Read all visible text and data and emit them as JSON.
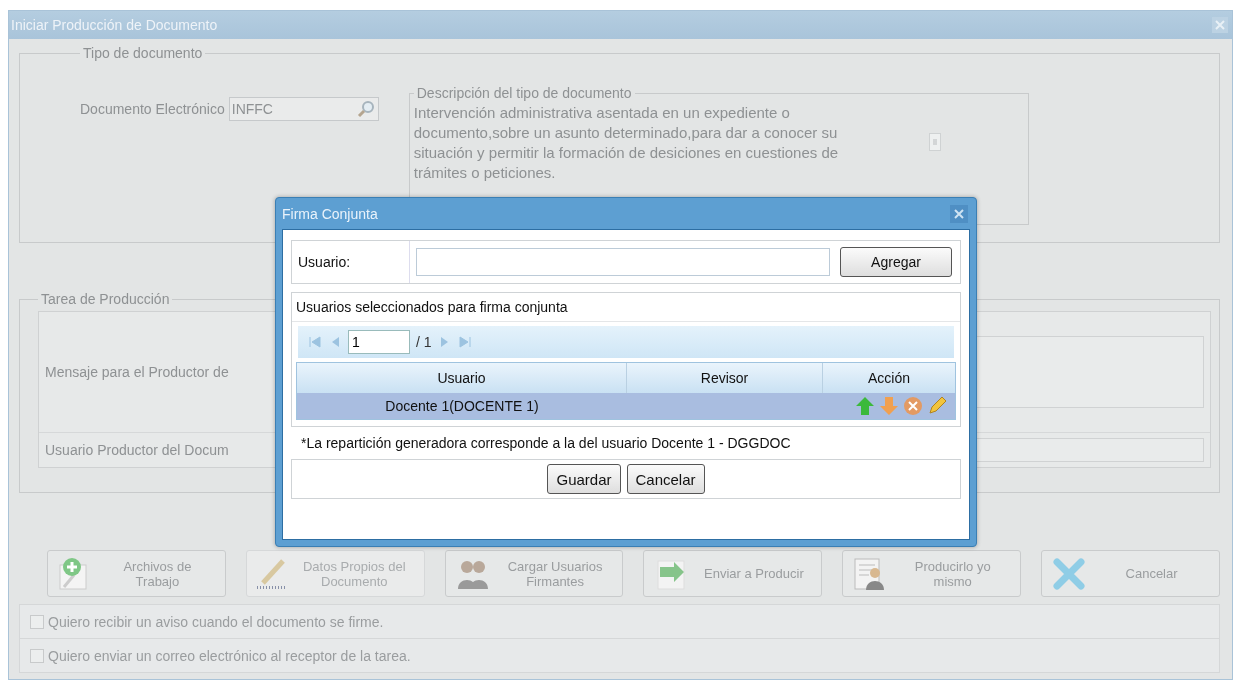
{
  "window": {
    "title": "Iniciar Producción de Documento"
  },
  "tipo_documento": {
    "legend": "Tipo de documento",
    "field_label": "Documento Electrónico",
    "field_value": "INFFC",
    "description": {
      "legend": "Descripción del tipo de documento",
      "text": "Intervención administrativa asentada en un expediente o documento,sobre un asunto determinado,para dar a conocer su situación y permitir la formación de desiciones en cuestiones de trámites o peticiones."
    }
  },
  "tarea": {
    "legend": "Tarea de Producción",
    "message_label": "Mensaje para el Productor de",
    "user_label": "Usuario Productor del Docum"
  },
  "actions": [
    {
      "label": "Archivos de Trabajo",
      "disabled": false
    },
    {
      "label": "Datos Propios del Documento",
      "disabled": true
    },
    {
      "label": "Cargar Usuarios Firmantes",
      "disabled": false
    },
    {
      "label": "Enviar a Producir",
      "disabled": false
    },
    {
      "label": "Producirlo yo mismo",
      "disabled": false
    },
    {
      "label": "Cancelar",
      "disabled": false
    }
  ],
  "options": [
    {
      "label": "Quiero recibir un aviso cuando el documento se firme.",
      "checked": false
    },
    {
      "label": "Quiero enviar un correo electrónico al receptor de la tarea.",
      "checked": false
    }
  ],
  "dialog": {
    "title": "Firma Conjunta",
    "user_label": "Usuario:",
    "add_button": "Agregar",
    "list_title": "Usuarios seleccionados para firma conjunta",
    "pager": {
      "page": "1",
      "total": "/ 1"
    },
    "columns": [
      "Usuario",
      "Revisor",
      "Acción"
    ],
    "rows": [
      {
        "usuario": "Docente 1(DOCENTE 1)",
        "selected": true
      }
    ],
    "note": "*La repartición generadora corresponde a la del usuario Docente 1 - DGGDOC",
    "buttons": [
      "Guardar",
      "Cancelar"
    ]
  }
}
